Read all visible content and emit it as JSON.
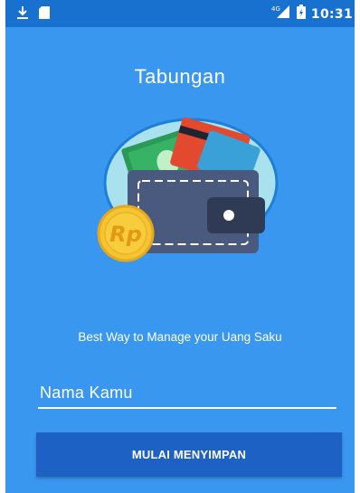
{
  "status_bar": {
    "time": "10:31",
    "network": "4G",
    "icons": [
      "download-icon",
      "sd-card-icon",
      "signal-icon",
      "battery-icon"
    ]
  },
  "app": {
    "title": "Tabungan",
    "tagline": "Best Way to Manage your Uang Saku",
    "currency_symbol": "Rp"
  },
  "form": {
    "name_placeholder": "Nama Kamu",
    "name_value": ""
  },
  "buttons": {
    "start_label": "MULAI MENYIMPAN"
  },
  "colors": {
    "background": "#3a97f0",
    "status_bar": "#1871cf",
    "button": "#1d61c4",
    "illustration_circle": "#a9e1ef",
    "wallet": "#4a5a7e",
    "coin": "#f6c431"
  }
}
